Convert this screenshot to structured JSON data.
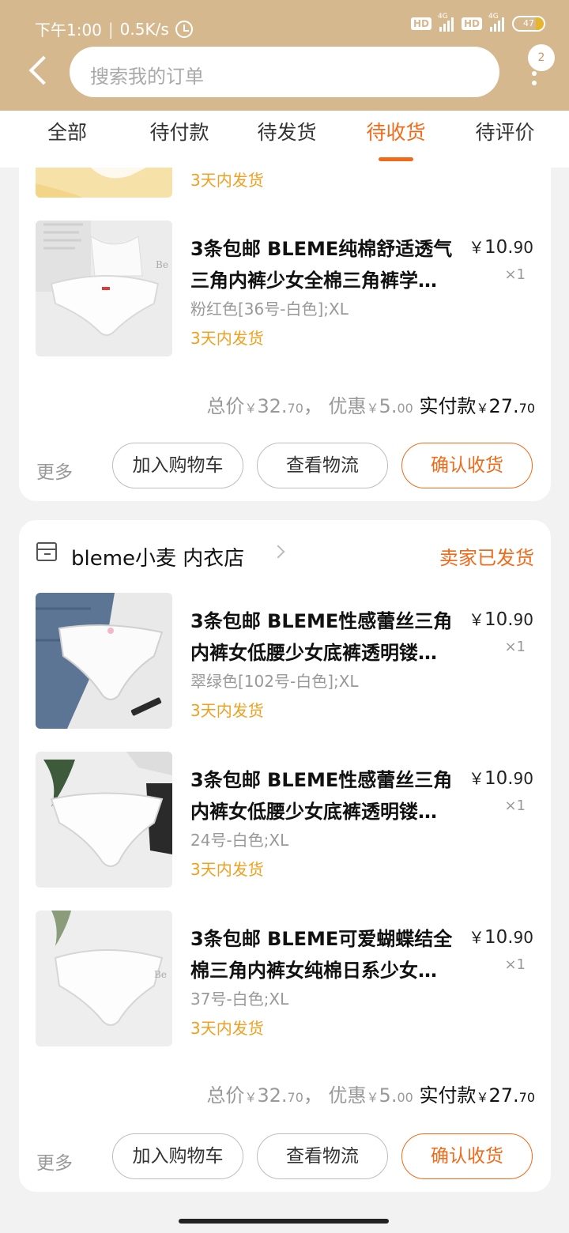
{
  "status_bar": {
    "time": "下午1:00",
    "speed": "0.5K/s",
    "hd1": "HD",
    "net1": "4G",
    "hd2": "HD",
    "net2": "4G",
    "battery": "47"
  },
  "header": {
    "search_placeholder": "搜索我的订单",
    "more_badge": "2"
  },
  "tabs": [
    {
      "label": "全部"
    },
    {
      "label": "待付款"
    },
    {
      "label": "待发货"
    },
    {
      "label": "待收货",
      "active": true
    },
    {
      "label": "待评价"
    }
  ],
  "order1": {
    "partial_ship": "3天内发货",
    "item": {
      "title_line1": "3条包邮 BLEME纯棉舒适透气",
      "title_line2": "三角内裤少女全棉三角裤学…",
      "sku": "粉红色[36号-白色];XL",
      "ship": "3天内发货",
      "price_symbol": "￥",
      "price_int": "10.",
      "price_dec": "90",
      "qty": "×1"
    },
    "summary": {
      "total_label": "总价",
      "total_symbol": "￥",
      "total_int": "32.",
      "total_dec": "70",
      "sep": "，",
      "discount_label": "优惠",
      "discount_symbol": "￥",
      "discount_int": "5.",
      "discount_dec": "00",
      "pay_label": "实付款",
      "pay_symbol": "￥",
      "pay_int": "27.",
      "pay_dec": "70"
    },
    "actions": {
      "more": "更多",
      "add_cart": "加入购物车",
      "logistics": "查看物流",
      "confirm": "确认收货"
    }
  },
  "order2": {
    "shop_name": "bleme小麦 内衣店",
    "status": "卖家已发货",
    "items": [
      {
        "title_line1": "3条包邮 BLEME性感蕾丝三角",
        "title_line2": "内裤女低腰少女底裤透明镂…",
        "sku": "翠绿色[102号-白色];XL",
        "ship": "3天内发货",
        "price_symbol": "￥",
        "price_int": "10.",
        "price_dec": "90",
        "qty": "×1"
      },
      {
        "title_line1": "3条包邮 BLEME性感蕾丝三角",
        "title_line2": "内裤女低腰少女底裤透明镂…",
        "sku": "24号-白色;XL",
        "ship": "3天内发货",
        "price_symbol": "￥",
        "price_int": "10.",
        "price_dec": "90",
        "qty": "×1"
      },
      {
        "title_line1": "3条包邮 BLEME可爱蝴蝶结全",
        "title_line2": "棉三角内裤女纯棉日系少女…",
        "sku": "37号-白色;XL",
        "ship": "3天内发货",
        "price_symbol": "￥",
        "price_int": "10.",
        "price_dec": "90",
        "qty": "×1"
      }
    ],
    "summary": {
      "total_label": "总价",
      "total_symbol": "￥",
      "total_int": "32.",
      "total_dec": "70",
      "sep": "，",
      "discount_label": "优惠",
      "discount_symbol": "￥",
      "discount_int": "5.",
      "discount_dec": "00",
      "pay_label": "实付款",
      "pay_symbol": "￥",
      "pay_int": "27.",
      "pay_dec": "70"
    },
    "actions": {
      "more": "更多",
      "add_cart": "加入购物车",
      "logistics": "查看物流",
      "confirm": "确认收货"
    }
  },
  "colors": {
    "header_bg": "#d6b88f",
    "accent": "#f06a1a",
    "ship_text": "#f0a020"
  }
}
